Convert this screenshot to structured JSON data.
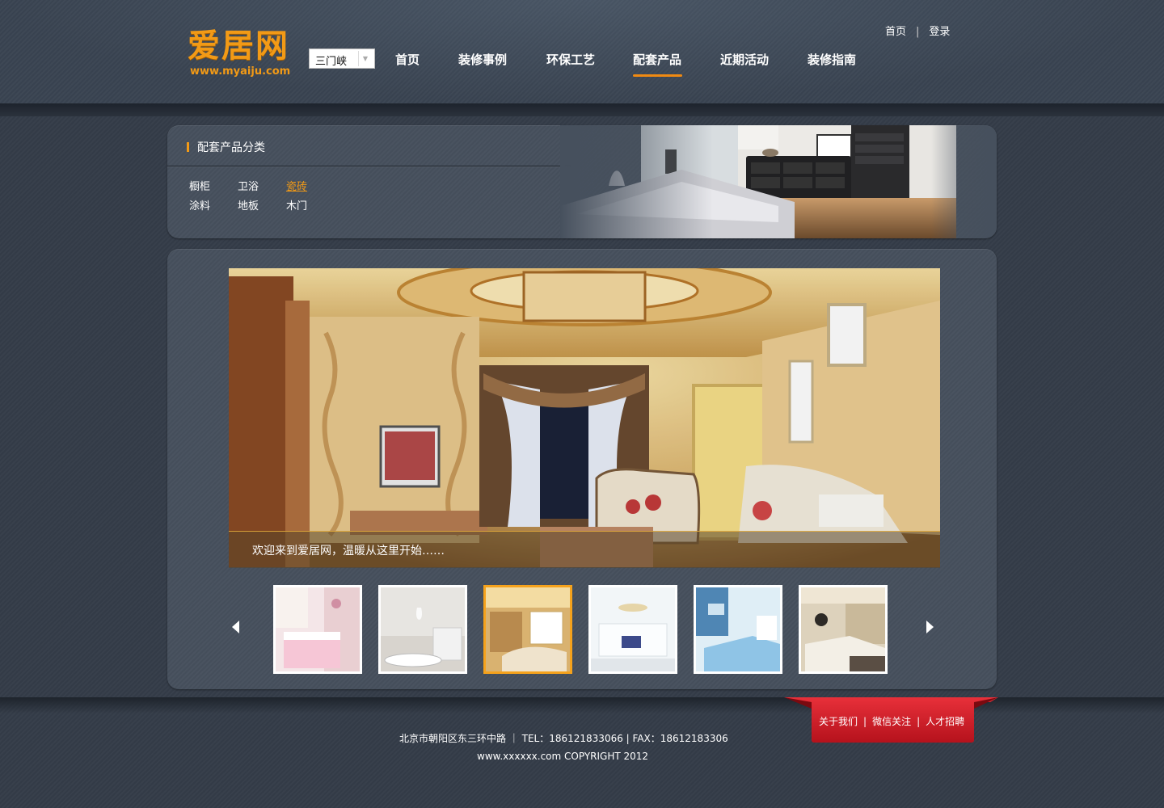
{
  "header": {
    "logo_text": "爱居网",
    "logo_url": "www.myaiju.com",
    "city_select": "三门峡",
    "top_links": [
      "首页",
      "登录"
    ],
    "nav": [
      "首页",
      "装修事例",
      "环保工艺",
      "配套产品",
      "近期活动",
      "装修指南"
    ],
    "active_nav": "配套产品",
    "accent": "#f29a16"
  },
  "category": {
    "title": "配套产品分类",
    "items": [
      "橱柜",
      "卫浴",
      "瓷砖",
      "涂料",
      "地板",
      "木门"
    ],
    "active_item": "瓷砖"
  },
  "gallery": {
    "caption": "欢迎来到爱居网，温暖从这里开始……",
    "prev_icon": "arrow-left-icon",
    "next_icon": "arrow-right-icon",
    "active_thumb_index": 2
  },
  "footer": {
    "address": "北京市朝阳区东三环中路 ｜ TEL：186121833066 | FAX：18612183306",
    "copyright": "www.xxxxxx.com COPYRIGHT 2012",
    "links": [
      "关于我们",
      "微信关注",
      "人才招聘"
    ]
  }
}
